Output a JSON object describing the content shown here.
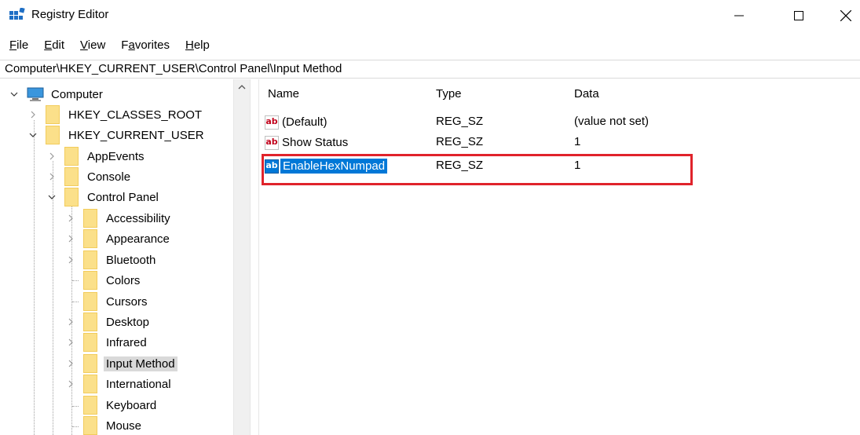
{
  "window": {
    "title": "Registry Editor",
    "accent": "#0078d7",
    "highlight_color": "#e0232b"
  },
  "menu": [
    {
      "label": "File",
      "accel": "F",
      "rest": "ile"
    },
    {
      "label": "Edit",
      "accel": "E",
      "rest": "dit"
    },
    {
      "label": "View",
      "accel": "V",
      "rest": "iew"
    },
    {
      "label": "Favorites",
      "pre": "F",
      "accel": "a",
      "rest": "vorites"
    },
    {
      "label": "Help",
      "accel": "H",
      "rest": "elp"
    }
  ],
  "address": "Computer\\HKEY_CURRENT_USER\\Control Panel\\Input Method",
  "tree": {
    "root": "Computer",
    "hkcr": "HKEY_CLASSES_ROOT",
    "hkcu": "HKEY_CURRENT_USER",
    "appevents": "AppEvents",
    "console": "Console",
    "control_panel": "Control Panel",
    "accessibility": "Accessibility",
    "appearance": "Appearance",
    "bluetooth": "Bluetooth",
    "colors": "Colors",
    "cursors": "Cursors",
    "desktop": "Desktop",
    "infrared": "Infrared",
    "input_method": "Input Method",
    "international": "International",
    "keyboard": "Keyboard",
    "mouse": "Mouse"
  },
  "list": {
    "headers": {
      "name": "Name",
      "type": "Type",
      "data": "Data"
    },
    "rows": [
      {
        "name": "(Default)",
        "type": "REG_SZ",
        "data": "(value not set)"
      },
      {
        "name": "Show Status",
        "type": "REG_SZ",
        "data": "1"
      },
      {
        "name": "EnableHexNumpad",
        "type": "REG_SZ",
        "data": "1"
      }
    ]
  },
  "icons": {
    "string_value": "ab"
  }
}
